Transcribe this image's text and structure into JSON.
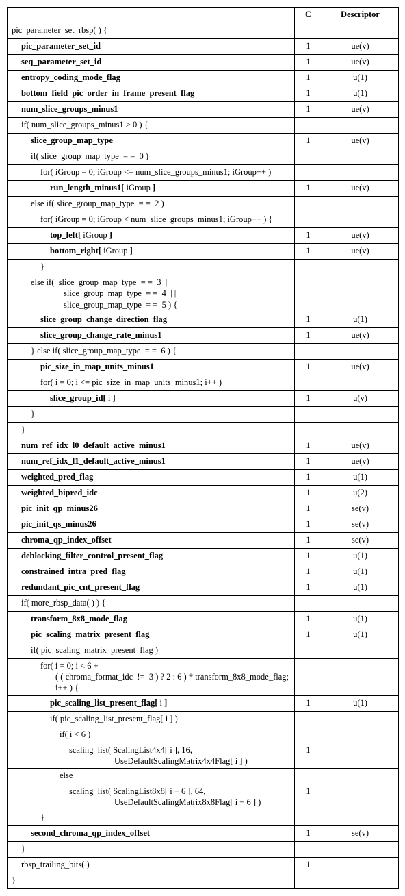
{
  "header": {
    "c": "C",
    "d": "Descriptor"
  },
  "rows": [
    {
      "indent": 0,
      "html": "pic_parameter_set_rbsp( ) {",
      "c": "",
      "d": ""
    },
    {
      "indent": 1,
      "html": "<span class='b'>pic_parameter_set_id</span>",
      "c": "1",
      "d": "ue(v)"
    },
    {
      "indent": 1,
      "html": "<span class='b'>seq_parameter_set_id</span>",
      "c": "1",
      "d": "ue(v)"
    },
    {
      "indent": 1,
      "html": "<span class='b'>entropy_coding_mode_flag</span>",
      "c": "1",
      "d": "u(1)"
    },
    {
      "indent": 1,
      "html": "<span class='b'>bottom_field_pic_order_in_frame_present_flag</span>",
      "c": "1",
      "d": "u(1)"
    },
    {
      "indent": 1,
      "html": "<span class='b'>num_slice_groups_minus1</span>",
      "c": "1",
      "d": "ue(v)"
    },
    {
      "indent": 1,
      "html": "if( num_slice_groups_minus1 &gt; 0 ) {",
      "c": "",
      "d": ""
    },
    {
      "indent": 2,
      "html": "<span class='b'>slice_group_map_type</span>",
      "c": "1",
      "d": "ue(v)"
    },
    {
      "indent": 2,
      "html": "if( slice_group_map_type &nbsp;= = &nbsp;0 )",
      "c": "",
      "d": ""
    },
    {
      "indent": 3,
      "html": "for( iGroup = 0; iGroup &lt;= num_slice_groups_minus1; iGroup++ )",
      "c": "",
      "d": ""
    },
    {
      "indent": 4,
      "html": "<span class='b'>run_length_minus1[</span> iGroup <span class='b'>]</span>",
      "c": "1",
      "d": "ue(v)"
    },
    {
      "indent": 2,
      "html": "else if( slice_group_map_type &nbsp;= = &nbsp;2 )",
      "c": "",
      "d": ""
    },
    {
      "indent": 3,
      "html": "for( iGroup = 0; iGroup &lt; num_slice_groups_minus1; iGroup++ ) {",
      "c": "",
      "d": ""
    },
    {
      "indent": 4,
      "html": "<span class='b'>top_left[</span> iGroup <span class='b'>]</span>",
      "c": "1",
      "d": "ue(v)"
    },
    {
      "indent": 4,
      "html": "<span class='b'>bottom_right[</span> iGroup <span class='b'>]</span>",
      "c": "1",
      "d": "ue(v)"
    },
    {
      "indent": 3,
      "html": "}",
      "c": "",
      "d": ""
    },
    {
      "indent": 2,
      "html": "else if( &nbsp;slice_group_map_type &nbsp;= = &nbsp;3 &nbsp;| |<br><span style='display:inline-block;width:48px'></span>slice_group_map_type &nbsp;= = &nbsp;4 &nbsp;| |<br><span style='display:inline-block;width:48px'></span>slice_group_map_type &nbsp;= = &nbsp;5 ) {",
      "c": "",
      "d": ""
    },
    {
      "indent": 3,
      "html": "<span class='b'>slice_group_change_direction_flag</span>",
      "c": "1",
      "d": "u(1)"
    },
    {
      "indent": 3,
      "html": "<span class='b'>slice_group_change_rate_minus1</span>",
      "c": "1",
      "d": "ue(v)"
    },
    {
      "indent": 2,
      "html": "} else if( slice_group_map_type &nbsp;= = &nbsp;6 ) {",
      "c": "",
      "d": ""
    },
    {
      "indent": 3,
      "html": "<span class='b'>pic_size_in_map_units_minus1</span>",
      "c": "1",
      "d": "ue(v)"
    },
    {
      "indent": 3,
      "html": "for( i = 0; i &lt;= pic_size_in_map_units_minus1; i++ )",
      "c": "",
      "d": ""
    },
    {
      "indent": 4,
      "html": "<span class='b'>slice_group_id[</span> i <span class='b'>]</span>",
      "c": "1",
      "d": "u(v)"
    },
    {
      "indent": 2,
      "html": "}",
      "c": "",
      "d": ""
    },
    {
      "indent": 1,
      "html": "}",
      "c": "",
      "d": ""
    },
    {
      "indent": 1,
      "html": "<span class='b'>num_ref_idx_l0_default_active_minus1</span>",
      "c": "1",
      "d": "ue(v)"
    },
    {
      "indent": 1,
      "html": "<span class='b'>num_ref_idx_l1_default_active_minus1</span>",
      "c": "1",
      "d": "ue(v)"
    },
    {
      "indent": 1,
      "html": "<span class='b'>weighted_pred_flag</span>",
      "c": "1",
      "d": "u(1)"
    },
    {
      "indent": 1,
      "html": "<span class='b'>weighted_bipred_idc</span>",
      "c": "1",
      "d": "u(2)"
    },
    {
      "indent": 1,
      "html": "<span class='b'>pic_init_qp_minus26</span>",
      "c": "1",
      "d": "se(v)"
    },
    {
      "indent": 1,
      "html": "<span class='b'>pic_init_qs_minus26</span>",
      "c": "1",
      "d": "se(v)"
    },
    {
      "indent": 1,
      "html": "<span class='b'>chroma_qp_index_offset</span>",
      "c": "1",
      "d": "se(v)"
    },
    {
      "indent": 1,
      "html": "<span class='b'>deblocking_filter_control_present_flag</span>",
      "c": "1",
      "d": "u(1)"
    },
    {
      "indent": 1,
      "html": "<span class='b'>constrained_intra_pred_flag</span>",
      "c": "1",
      "d": "u(1)"
    },
    {
      "indent": 1,
      "html": "<span class='b'>redundant_pic_cnt_present_flag</span>",
      "c": "1",
      "d": "u(1)"
    },
    {
      "indent": 1,
      "html": "if( more_rbsp_data( ) ) {",
      "c": "",
      "d": ""
    },
    {
      "indent": 2,
      "html": "<span class='b'>transform_8x8_mode_flag</span>",
      "c": "1",
      "d": "u(1)"
    },
    {
      "indent": 2,
      "html": "<span class='b'>pic_scaling_matrix_present_flag</span>",
      "c": "1",
      "d": "u(1)"
    },
    {
      "indent": 2,
      "html": "if( pic_scaling_matrix_present_flag )",
      "c": "",
      "d": ""
    },
    {
      "indent": 3,
      "html": "for( i = 0; i &lt; 6 +<br><span style='display:inline-block;width:22px'></span>( ( chroma_format_idc &nbsp;!= &nbsp;3 ) ? 2 : 6 ) * transform_8x8_mode_flag;<br><span style='display:inline-block;width:22px'></span>i++ ) {",
      "c": "",
      "d": ""
    },
    {
      "indent": 4,
      "html": "<span class='b'>pic_scaling_list_present_flag[</span> i <span class='b'>]</span>",
      "c": "1",
      "d": "u(1)"
    },
    {
      "indent": 4,
      "html": "if( pic_scaling_list_present_flag[ i ] )",
      "c": "",
      "d": ""
    },
    {
      "indent": 5,
      "html": "if( i &lt; 6 )",
      "c": "",
      "d": ""
    },
    {
      "indent": 6,
      "html": "scaling_list( ScalingList4x4[ i ], 16,<br><span style='display:inline-block;width:66px'></span>UseDefaultScalingMatrix4x4Flag[ i ] )",
      "c": "1",
      "d": ""
    },
    {
      "indent": 5,
      "html": "else",
      "c": "",
      "d": ""
    },
    {
      "indent": 6,
      "html": "scaling_list( ScalingList8x8[ i &minus; 6 ], 64,<br><span style='display:inline-block;width:66px'></span>UseDefaultScalingMatrix8x8Flag[ i &minus; 6 ] )",
      "c": "1",
      "d": ""
    },
    {
      "indent": 3,
      "html": "}",
      "c": "",
      "d": ""
    },
    {
      "indent": 2,
      "html": "<span class='b'>second_chroma_qp_index_offset</span>",
      "c": "1",
      "d": "se(v)"
    },
    {
      "indent": 1,
      "html": "}",
      "c": "",
      "d": ""
    },
    {
      "indent": 1,
      "html": "rbsp_trailing_bits( )",
      "c": "1",
      "d": ""
    },
    {
      "indent": 0,
      "html": "}",
      "c": "",
      "d": ""
    }
  ]
}
